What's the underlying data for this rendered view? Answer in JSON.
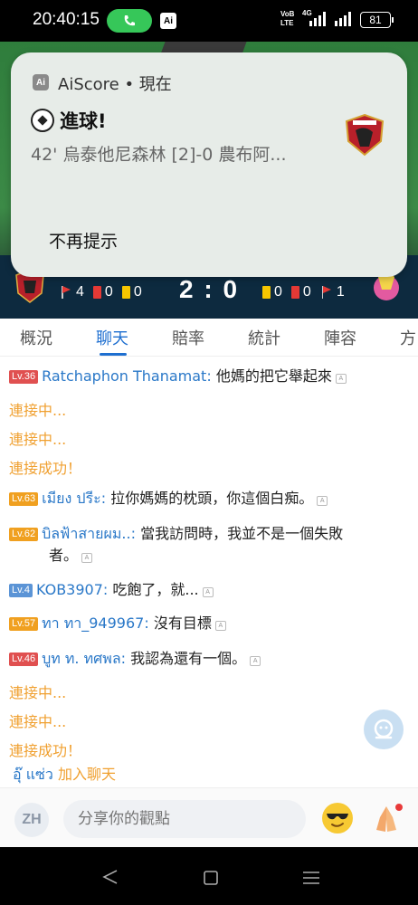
{
  "status_bar": {
    "time": "20:40:15",
    "app_chip": "Ai",
    "network_top": "VoB",
    "network_bottom": "LTE",
    "network_gen": "4G",
    "battery": "81"
  },
  "notification": {
    "app_icon_text": "Ai",
    "app_line": "AiScore • 現在",
    "title": "進球!",
    "body": "42' 烏泰他尼森林 [2]-0 農布阿...",
    "dismiss_label": "不再提示"
  },
  "match": {
    "home_corners": "4",
    "home_red": "0",
    "home_yellow": "0",
    "score": "2 : 0",
    "away_yellow": "0",
    "away_red": "0",
    "away_corners": "1"
  },
  "tabs": [
    "概況",
    "聊天",
    "賠率",
    "統計",
    "陣容",
    "方"
  ],
  "active_tab": "聊天",
  "chat": {
    "messages": [
      {
        "level": "Lv.36",
        "user": "Ratchaphon Thanamat:",
        "text": "他媽的把它舉起來"
      },
      {
        "system": "連接中..."
      },
      {
        "system": "連接中..."
      },
      {
        "system": "連接成功！"
      },
      {
        "level": "Lv.63",
        "user": "เมียง ปรีะ:",
        "text": "拉你媽媽的枕頭，你這個白痴。"
      },
      {
        "level": "Lv.62",
        "user": "บิลฟ้าสายผม..:",
        "text": "當我訪問時，我並不是一個失敗",
        "text2": "者。"
      },
      {
        "level": "Lv.4",
        "user": "KOB3907:",
        "text": "吃飽了，就..."
      },
      {
        "level": "Lv.57",
        "user": "ทา ทา_949967:",
        "text": "沒有目標"
      },
      {
        "level": "Lv.46",
        "user": "บูท ท. ทศพล:",
        "text": "我認為還有一個。"
      },
      {
        "system": "連接中..."
      },
      {
        "system": "連接中..."
      },
      {
        "system": "連接成功！"
      },
      {
        "user_join": "อุ๊ แซ่ว",
        "join_text": "加入聊天"
      }
    ]
  },
  "input": {
    "avatar_text": "ZH",
    "placeholder": "分享你的觀點"
  },
  "colors": {
    "accent": "#1e6fd0",
    "system_text": "#f0a030",
    "username": "#2a78c8"
  }
}
